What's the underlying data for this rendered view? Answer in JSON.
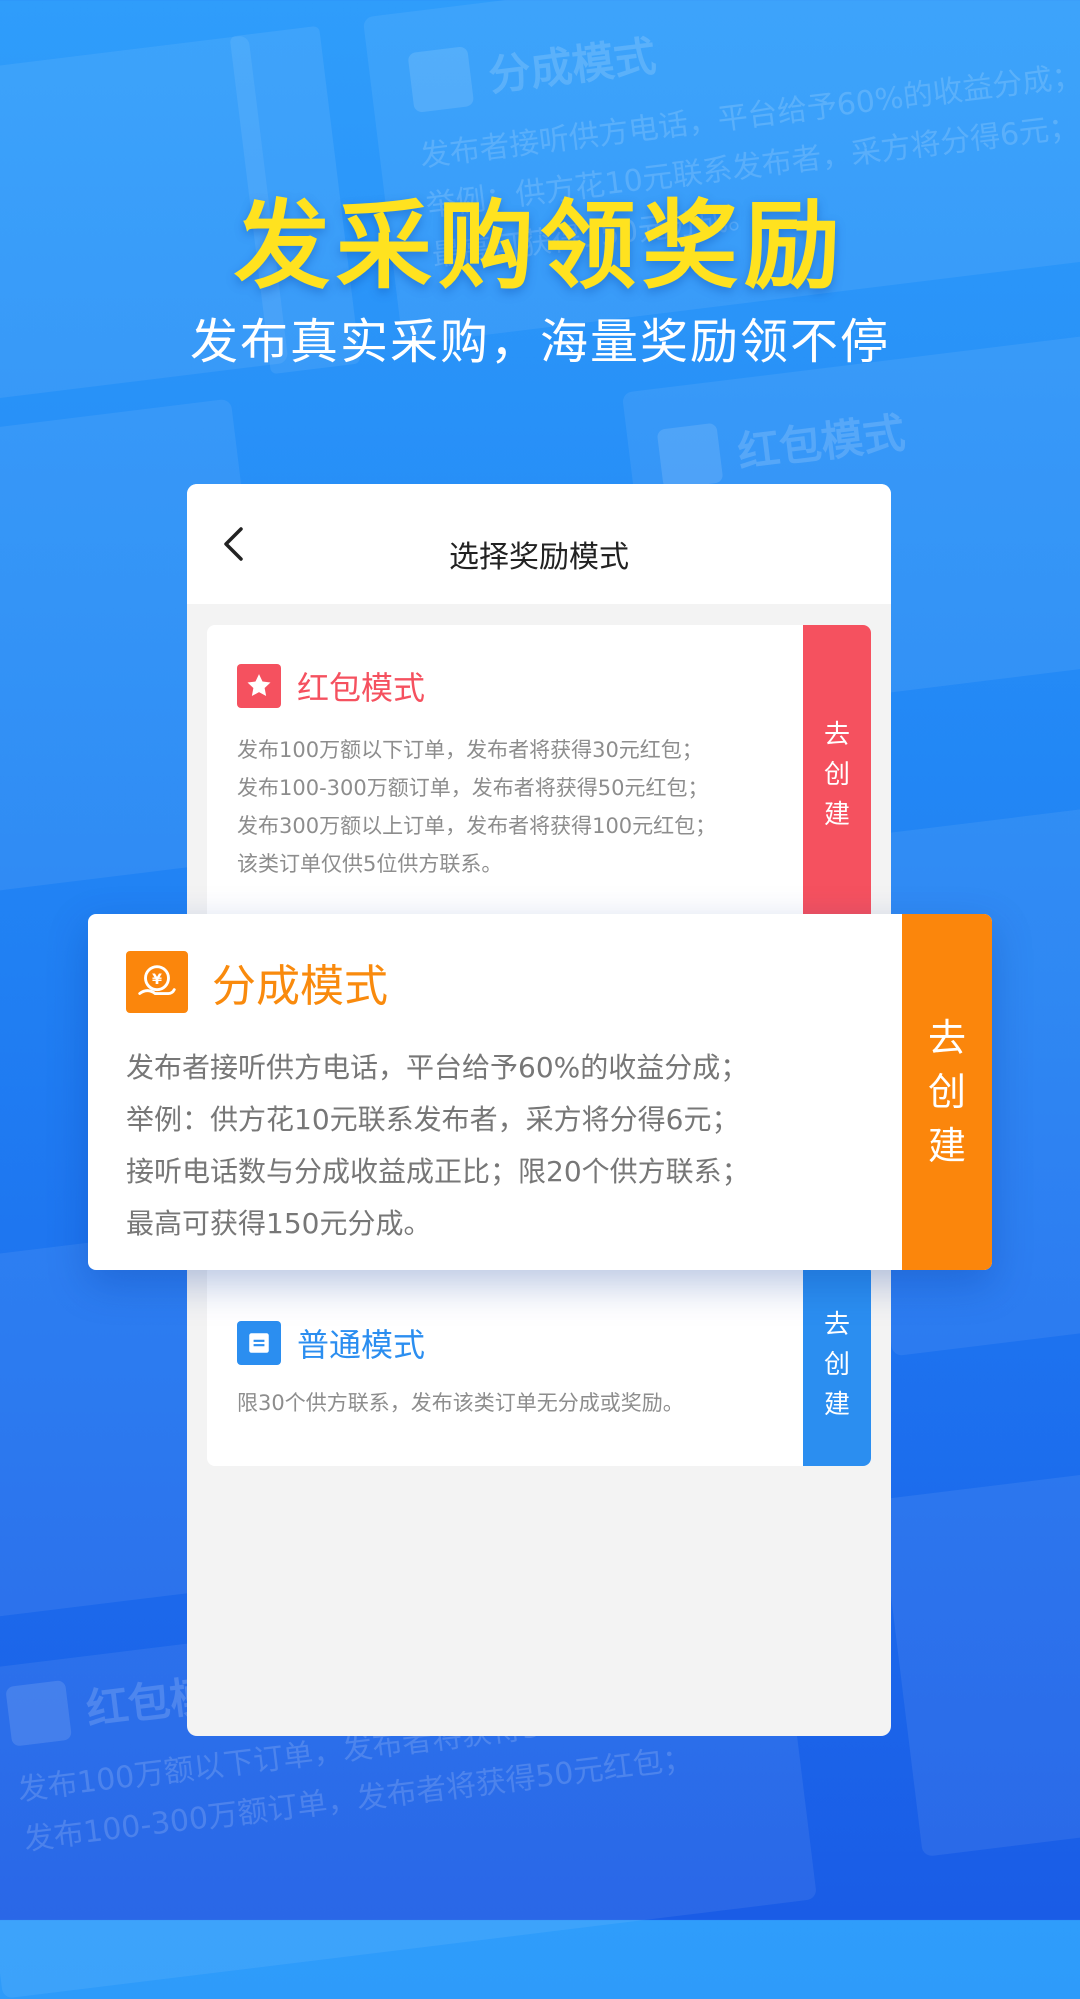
{
  "hero": {
    "title": "发采购领奖励",
    "subtitle": "发布真实采购，海量奖励领不停"
  },
  "screen": {
    "title": "选择奖励模式",
    "back_icon": "chevron-left-icon"
  },
  "modes": {
    "red_packet": {
      "title": "红包模式",
      "icon": "star-icon",
      "color": "#f5515f",
      "lines": [
        "发布100万额以下订单，发布者将获得30元红包；",
        "发布100-300万额订单，发布者将获得50元红包；",
        "发布300万额以上订单，发布者将获得100元红包；",
        "该类订单仅供5位供方联系。"
      ],
      "button": [
        "去",
        "创",
        "建"
      ]
    },
    "revenue_share": {
      "title": "分成模式",
      "icon": "yuan-hand-icon",
      "color": "#fb860c",
      "lines": [
        "发布者接听供方电话，平台给予60%的收益分成；",
        "举例：供方花10元联系发布者，采方将分得6元；",
        "接听电话数与分成收益成正比；限20个供方联系；",
        "最高可获得150元分成。"
      ],
      "button": [
        "去",
        "创",
        "建"
      ]
    },
    "normal": {
      "title": "普通模式",
      "icon": "document-icon",
      "color": "#2b8ef0",
      "lines": [
        "限30个供方联系，发布该类订单无分成或奖励。"
      ],
      "button": [
        "去",
        "创",
        "建"
      ]
    }
  }
}
